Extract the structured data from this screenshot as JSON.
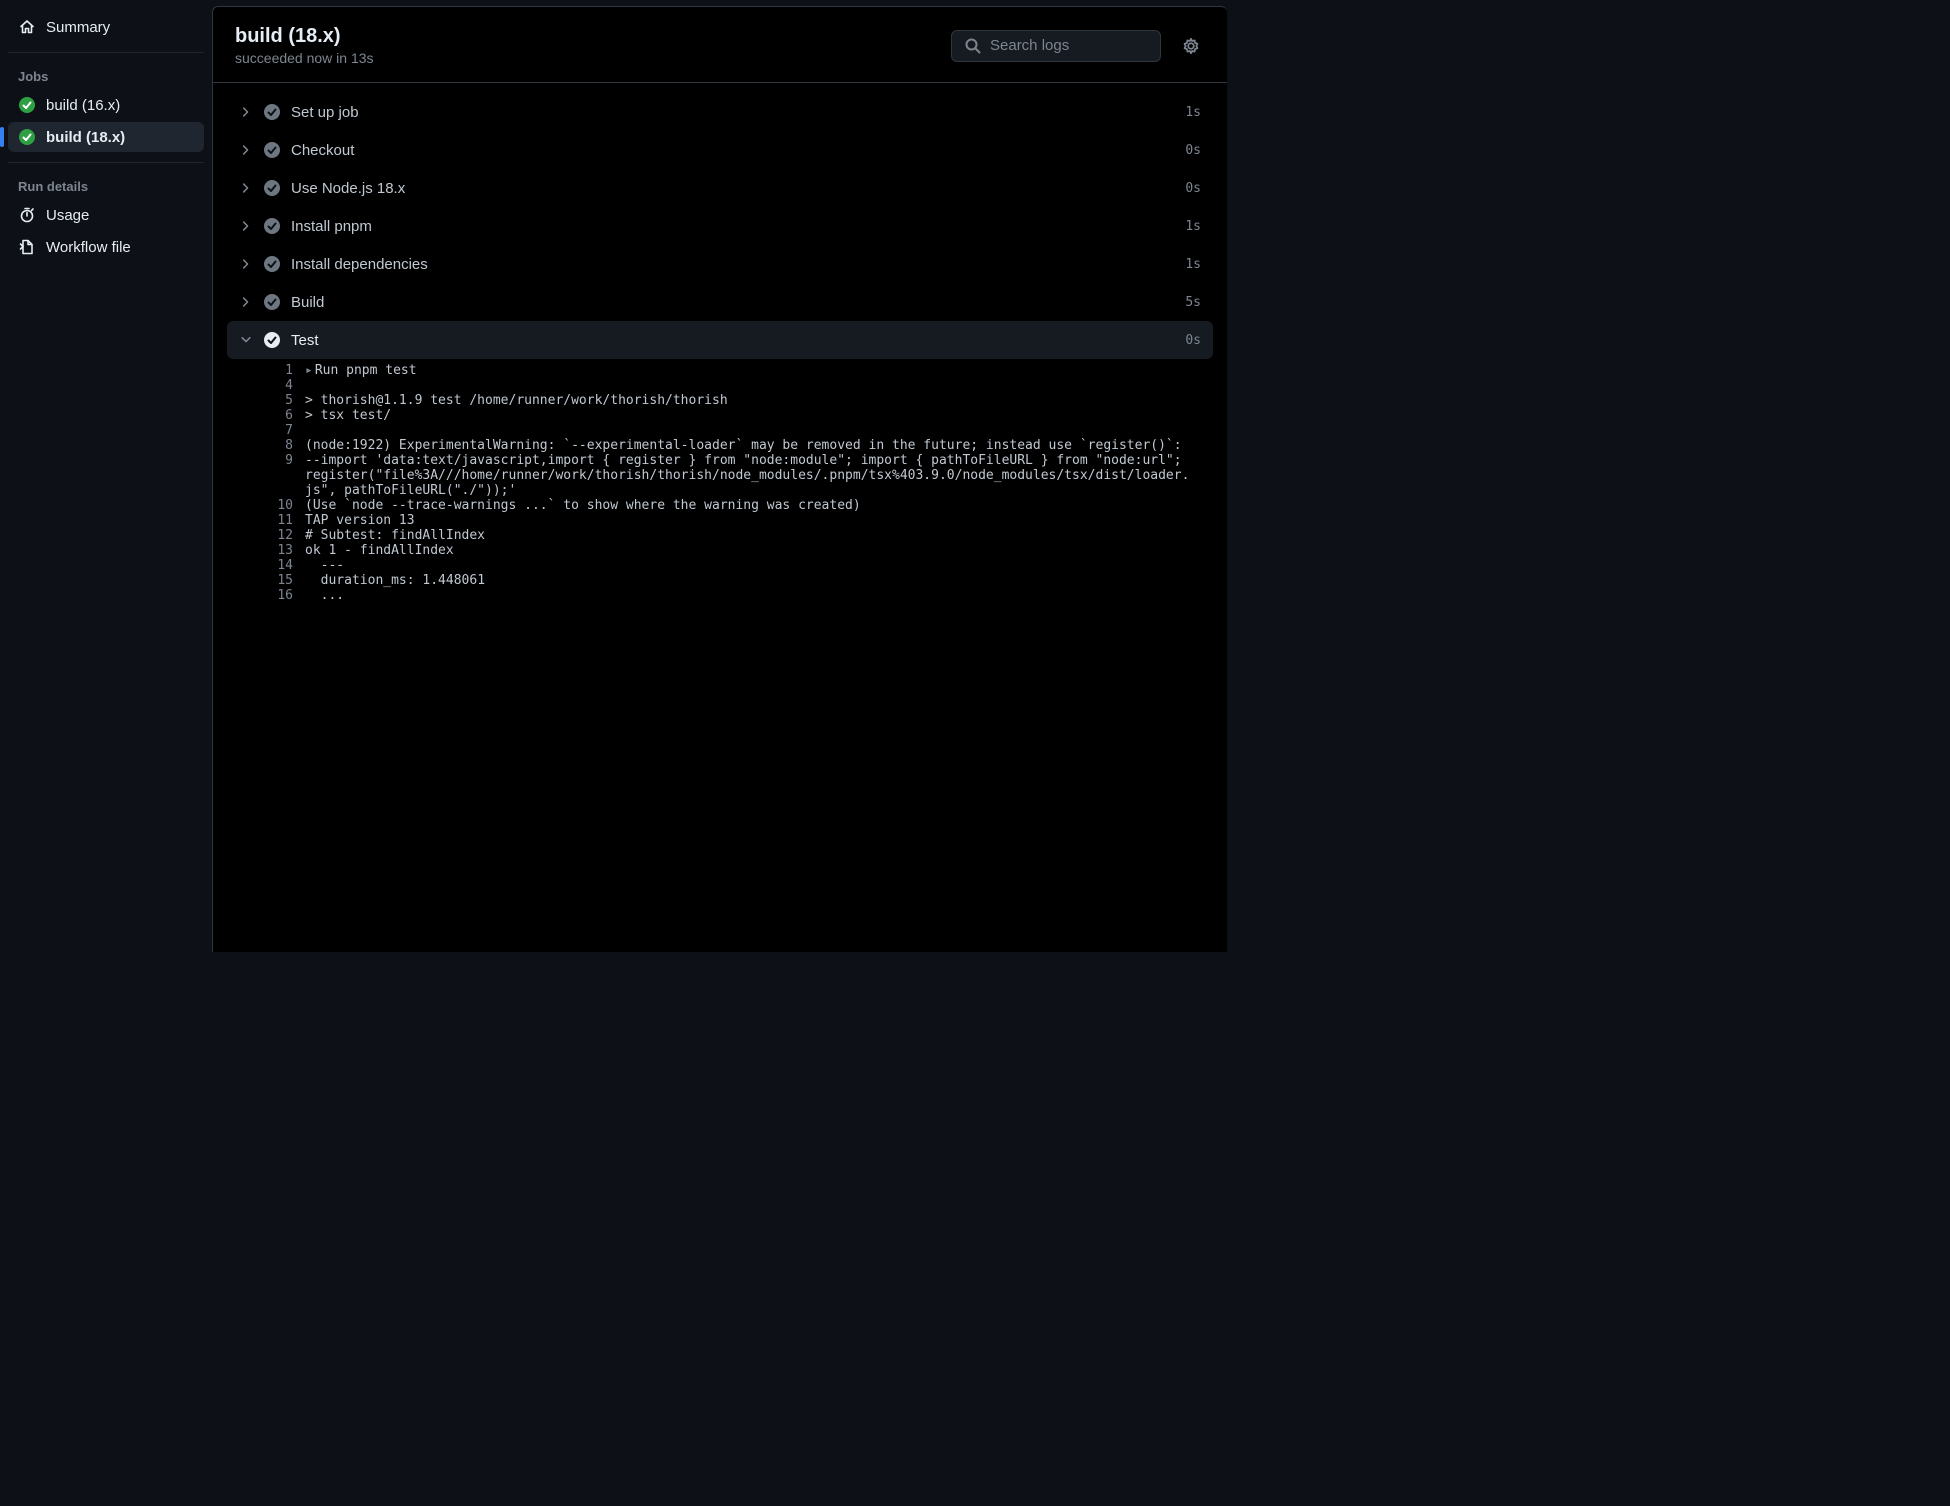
{
  "sidebar": {
    "summary": "Summary",
    "jobs_heading": "Jobs",
    "jobs": [
      {
        "label": "build (16.x)",
        "selected": false
      },
      {
        "label": "build (18.x)",
        "selected": true
      }
    ],
    "run_details_heading": "Run details",
    "details": [
      {
        "icon": "stopwatch",
        "label": "Usage"
      },
      {
        "icon": "file",
        "label": "Workflow file"
      }
    ]
  },
  "header": {
    "title": "build (18.x)",
    "subtitle": "succeeded now in 13s",
    "search_placeholder": "Search logs"
  },
  "steps": [
    {
      "name": "Set up job",
      "duration": "1s",
      "expanded": false,
      "status": "success"
    },
    {
      "name": "Checkout",
      "duration": "0s",
      "expanded": false,
      "status": "success"
    },
    {
      "name": "Use Node.js 18.x",
      "duration": "0s",
      "expanded": false,
      "status": "success"
    },
    {
      "name": "Install pnpm",
      "duration": "1s",
      "expanded": false,
      "status": "success"
    },
    {
      "name": "Install dependencies",
      "duration": "1s",
      "expanded": false,
      "status": "success"
    },
    {
      "name": "Build",
      "duration": "5s",
      "expanded": false,
      "status": "success"
    },
    {
      "name": "Test",
      "duration": "0s",
      "expanded": true,
      "status": "success"
    }
  ],
  "log": [
    {
      "n": "1",
      "text": "Run pnpm test",
      "fold": true
    },
    {
      "n": "4",
      "text": ""
    },
    {
      "n": "5",
      "text": "> thorish@1.1.9 test /home/runner/work/thorish/thorish"
    },
    {
      "n": "6",
      "text": "> tsx test/"
    },
    {
      "n": "7",
      "text": ""
    },
    {
      "n": "8",
      "text": "(node:1922) ExperimentalWarning: `--experimental-loader` may be removed in the future; instead use `register()`:"
    },
    {
      "n": "9",
      "text": "--import 'data:text/javascript,import { register } from \"node:module\"; import { pathToFileURL } from \"node:url\"; register(\"file%3A///home/runner/work/thorish/thorish/node_modules/.pnpm/tsx%403.9.0/node_modules/tsx/dist/loader.js\", pathToFileURL(\"./\"));'"
    },
    {
      "n": "10",
      "text": "(Use `node --trace-warnings ...` to show where the warning was created)"
    },
    {
      "n": "11",
      "text": "TAP version 13"
    },
    {
      "n": "12",
      "text": "# Subtest: findAllIndex"
    },
    {
      "n": "13",
      "text": "ok 1 - findAllIndex"
    },
    {
      "n": "14",
      "text": "  ---"
    },
    {
      "n": "15",
      "text": "  duration_ms: 1.448061"
    },
    {
      "n": "16",
      "text": "  ..."
    }
  ]
}
